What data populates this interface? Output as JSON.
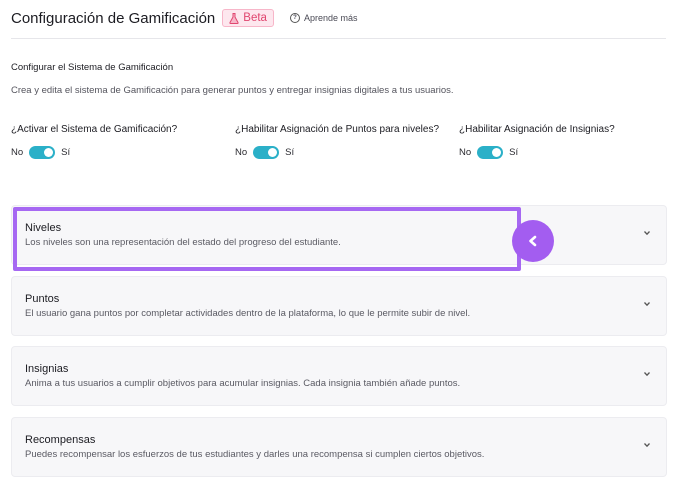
{
  "header": {
    "title": "Configuración de Gamificación",
    "beta_label": "Beta",
    "help_label": "Aprende más",
    "help_icon_glyph": "?"
  },
  "intro": {
    "title": "Configurar el Sistema de Gamificación",
    "description": "Crea y edita el sistema de Gamificación para generar puntos y entregar insignias digitales a tus usuarios."
  },
  "toggles": [
    {
      "question": "¿Activar el Sistema de Gamificación?",
      "off_label": "No",
      "on_label": "Sí",
      "state": "on"
    },
    {
      "question": "¿Habilitar Asignación de Puntos para niveles?",
      "off_label": "No",
      "on_label": "Sí",
      "state": "on"
    },
    {
      "question": "¿Habilitar Asignación de Insignias?",
      "off_label": "No",
      "on_label": "Sí",
      "state": "on"
    }
  ],
  "sections": [
    {
      "title": "Niveles",
      "description": "Los niveles son una representación del estado del progreso del estudiante."
    },
    {
      "title": "Puntos",
      "description": "El usuario gana puntos por completar actividades dentro de la plataforma, lo que le permite subir de nivel."
    },
    {
      "title": "Insignias",
      "description": "Anima a tus usuarios a cumplir objetivos para acumular insignias. Cada insignia también añade puntos."
    },
    {
      "title": "Recompensas",
      "description": "Puedes recompensar los esfuerzos de tus estudiantes y darles una recompensa si cumplen ciertos objetivos."
    }
  ],
  "colors": {
    "accent_toggle": "#2bb0c8",
    "highlight": "#a668f2",
    "beta_text": "#e0466f",
    "beta_bg": "#fde7ee"
  },
  "icons": {
    "beta": "flask-icon",
    "help": "question-circle-icon",
    "expand": "chevron-down-icon",
    "pointer": "chevron-left-icon"
  }
}
